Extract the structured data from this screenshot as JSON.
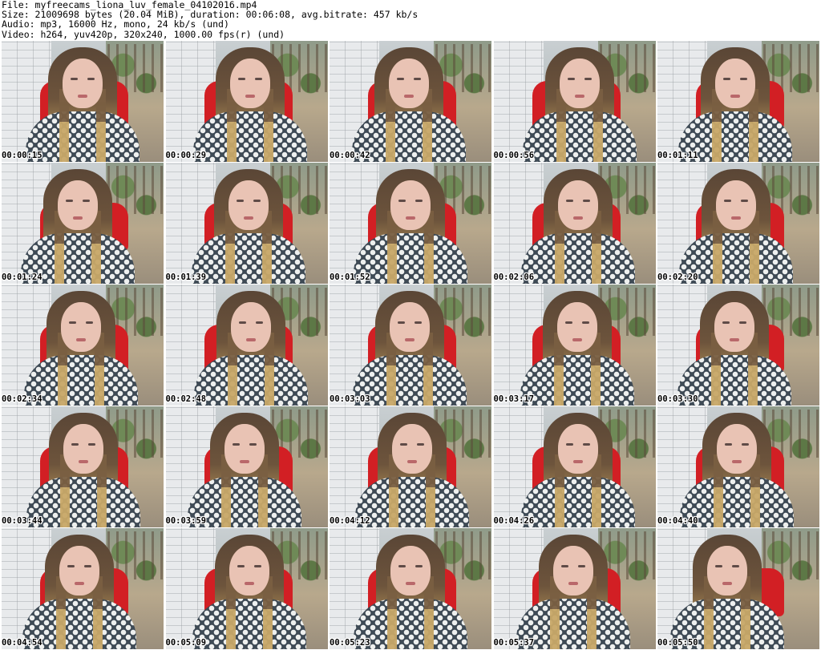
{
  "header": {
    "lines": [
      "File: myfreecams_liona_luv_female_04102016.mp4",
      "Size: 21009698 bytes (20.04 MiB), duration: 00:06:08, avg.bitrate: 457 kb/s",
      "Audio: mp3, 16000 Hz, mono, 24 kb/s (und)",
      "Video: h264, yuv420p, 320x240, 1000.00 fps(r) (und)"
    ]
  },
  "thumbnails": [
    {
      "timestamp": "00:00:15"
    },
    {
      "timestamp": "00:00:29"
    },
    {
      "timestamp": "00:00:42"
    },
    {
      "timestamp": "00:00:56"
    },
    {
      "timestamp": "00:01:11"
    },
    {
      "timestamp": "00:01:24"
    },
    {
      "timestamp": "00:01:39"
    },
    {
      "timestamp": "00:01:52"
    },
    {
      "timestamp": "00:02:06"
    },
    {
      "timestamp": "00:02:20"
    },
    {
      "timestamp": "00:02:34"
    },
    {
      "timestamp": "00:02:48"
    },
    {
      "timestamp": "00:03:03"
    },
    {
      "timestamp": "00:03:17"
    },
    {
      "timestamp": "00:03:30"
    },
    {
      "timestamp": "00:03:44"
    },
    {
      "timestamp": "00:03:59"
    },
    {
      "timestamp": "00:04:12"
    },
    {
      "timestamp": "00:04:26"
    },
    {
      "timestamp": "00:04:40"
    },
    {
      "timestamp": "00:04:54"
    },
    {
      "timestamp": "00:05:09"
    },
    {
      "timestamp": "00:05:23"
    },
    {
      "timestamp": "00:05:37"
    },
    {
      "timestamp": "00:05:50"
    }
  ]
}
